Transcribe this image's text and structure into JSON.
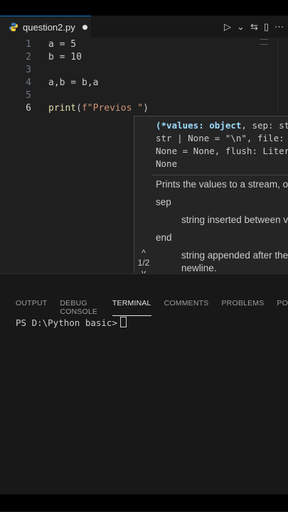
{
  "tab": {
    "filename": "question2.py"
  },
  "toolbar": {
    "run_icon": "▷",
    "dropdown_icon": "⌄",
    "compare_icon": "⇆",
    "split_icon": "▯",
    "more_icon": "⋯"
  },
  "editor": {
    "lines": [
      {
        "num": "1",
        "text": "a = 5"
      },
      {
        "num": "2",
        "text": "b = 10"
      },
      {
        "num": "3",
        "text": ""
      },
      {
        "num": "4",
        "text": "a,b = b,a"
      },
      {
        "num": "5",
        "text": ""
      },
      {
        "num": "6",
        "fn": "print",
        "open": "(",
        "str": "f\"Previos \"",
        "close": ")"
      }
    ]
  },
  "hover": {
    "sig_line1_bold": "(*values: object",
    "sig_line1_rest": ", sep: st",
    "sig_line2": "str | None = \"\\n\", file:",
    "sig_line3": "None = None, flush: Liter",
    "sig_line4": "None",
    "doc_intro": "Prints the values to a stream, or",
    "param1": "sep",
    "param1_desc": "string inserted between v",
    "param2": "end",
    "param2_desc1": "string appended after the",
    "param2_desc2": "newline.",
    "nav_up": "^",
    "nav_count": "1/2",
    "nav_down": "v"
  },
  "panel": {
    "tabs": [
      "OUTPUT",
      "DEBUG CONSOLE",
      "TERMINAL",
      "COMMENTS",
      "PROBLEMS",
      "PO"
    ],
    "active_tab": "TERMINAL",
    "prompt": "PS D:\\Python basic>"
  }
}
